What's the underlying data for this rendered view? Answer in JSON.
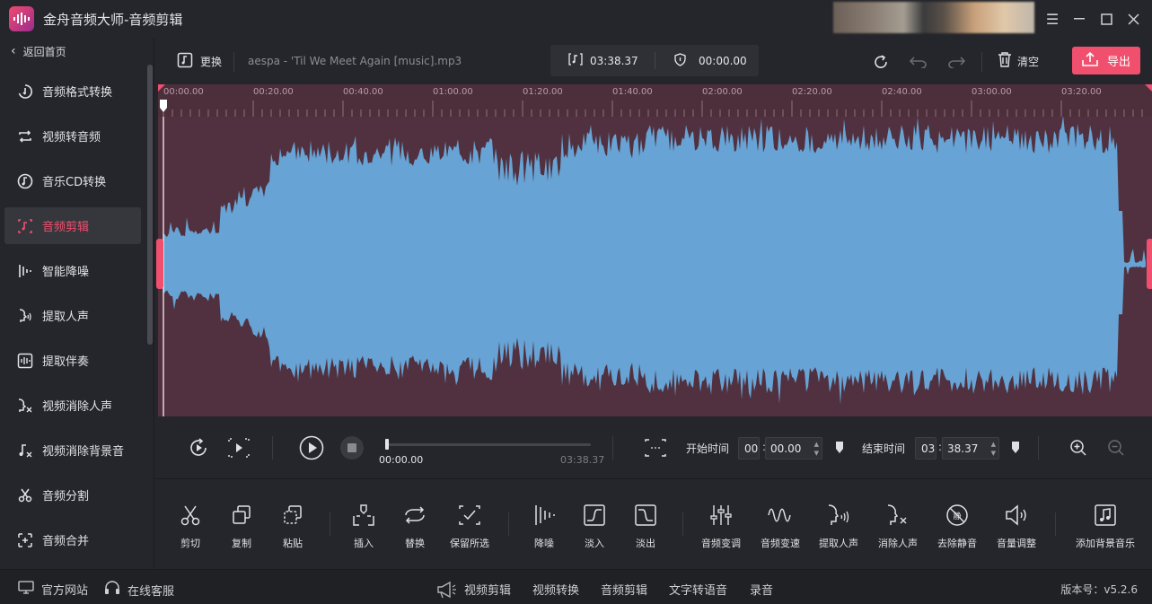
{
  "app": {
    "title": "金舟音频大师-音频剪辑",
    "accent": "#f0506e"
  },
  "sidebar": {
    "back_label": "返回首页",
    "items": [
      {
        "label": "音频格式转换",
        "icon": "convert-icon"
      },
      {
        "label": "视频转音频",
        "icon": "loop-icon"
      },
      {
        "label": "音乐CD转换",
        "icon": "music-cd-icon"
      },
      {
        "label": "音频剪辑",
        "icon": "audio-edit-icon",
        "active": true
      },
      {
        "label": "智能降噪",
        "icon": "denoise-icon"
      },
      {
        "label": "提取人声",
        "icon": "voice-icon"
      },
      {
        "label": "提取伴奏",
        "icon": "accompaniment-icon"
      },
      {
        "label": "视频消除人声",
        "icon": "remove-voice-icon"
      },
      {
        "label": "视频消除背景音",
        "icon": "remove-bg-icon"
      },
      {
        "label": "音频分割",
        "icon": "split-icon"
      },
      {
        "label": "音频合并",
        "icon": "merge-icon"
      }
    ]
  },
  "toolbar": {
    "replace_label": "更换",
    "filename": "aespa - 'Til We Meet Again [music].mp3",
    "total_duration": "03:38.37",
    "selection_duration": "00:00.00",
    "clear_label": "清空",
    "export_label": "导出"
  },
  "ruler": {
    "labels": [
      "00:00.00",
      "00:20.00",
      "00:40.00",
      "01:00.00",
      "01:20.00",
      "01:40.00",
      "02:00.00",
      "02:20.00",
      "02:40.00",
      "03:00.00",
      "03:20.00"
    ]
  },
  "playback": {
    "current_time": "00:00.00",
    "total_time": "03:38.37",
    "start_label": "开始时间",
    "start_min": "00",
    "start_sec": "00.00",
    "end_label": "结束时间",
    "end_min": "03",
    "end_sec": "38.37",
    "colon": ":"
  },
  "tools": [
    {
      "label": "剪切",
      "icon": "scissors-icon"
    },
    {
      "label": "复制",
      "icon": "copy-icon"
    },
    {
      "label": "粘贴",
      "icon": "paste-icon"
    },
    {
      "label": "插入",
      "icon": "insert-icon"
    },
    {
      "label": "替换",
      "icon": "replace-icon"
    },
    {
      "label": "保留所选",
      "icon": "keep-selection-icon"
    },
    {
      "label": "降噪",
      "icon": "noise-reduce-icon"
    },
    {
      "label": "淡入",
      "icon": "fade-in-icon"
    },
    {
      "label": "淡出",
      "icon": "fade-out-icon"
    },
    {
      "label": "音频变调",
      "icon": "pitch-icon"
    },
    {
      "label": "音频变速",
      "icon": "speed-icon"
    },
    {
      "label": "提取人声",
      "icon": "extract-voice-icon"
    },
    {
      "label": "消除人声",
      "icon": "erase-voice-icon"
    },
    {
      "label": "去除静音",
      "icon": "remove-silence-icon"
    },
    {
      "label": "音量调整",
      "icon": "volume-icon"
    },
    {
      "label": "添加背景音乐",
      "icon": "add-bgm-icon"
    }
  ],
  "statusbar": {
    "official_site": "官方网站",
    "support": "在线客服",
    "links": [
      "视频剪辑",
      "视频转换",
      "音频剪辑",
      "文字转语音",
      "录音"
    ],
    "version": "版本号：v5.2.6"
  }
}
